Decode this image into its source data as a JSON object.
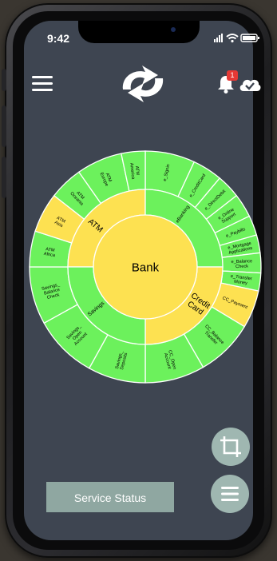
{
  "status_bar": {
    "time": "9:42"
  },
  "header": {
    "notification_count": "1",
    "icons": [
      "menu-icon",
      "sync-logo",
      "bell-icon",
      "cloud-check-icon"
    ]
  },
  "sunburst": {
    "root": "Bank",
    "groups": [
      "ATM",
      "eBanking",
      "Credit Card",
      "Savings"
    ],
    "leaves": {
      "atm": [
        "ATM America",
        "ATM Europe",
        "ATM Oceania",
        "ATM Asia",
        "ATM Africa"
      ],
      "ebanking": [
        "e_Signin",
        "e_CreditCard",
        "e_DirectDebit",
        "e_Online Support",
        "e_Paybills",
        "e_Mortgage Applications",
        "e_Balance Check",
        "e_Transfer Money"
      ],
      "credit_card": [
        "CC_Payment",
        "CC_Balance Transfer",
        "CC_Open Account"
      ],
      "savings": [
        "Savings_ Deposits",
        "Savings_ Open Account",
        "Savings_ Balance Check"
      ]
    },
    "colors": {
      "ok": "#6cf15c",
      "warn": "#fde151",
      "stroke": "#ffffff"
    }
  },
  "actions": {
    "service_status": "Service Status",
    "fab_icons": [
      "crop-icon",
      "menu-icon"
    ]
  }
}
